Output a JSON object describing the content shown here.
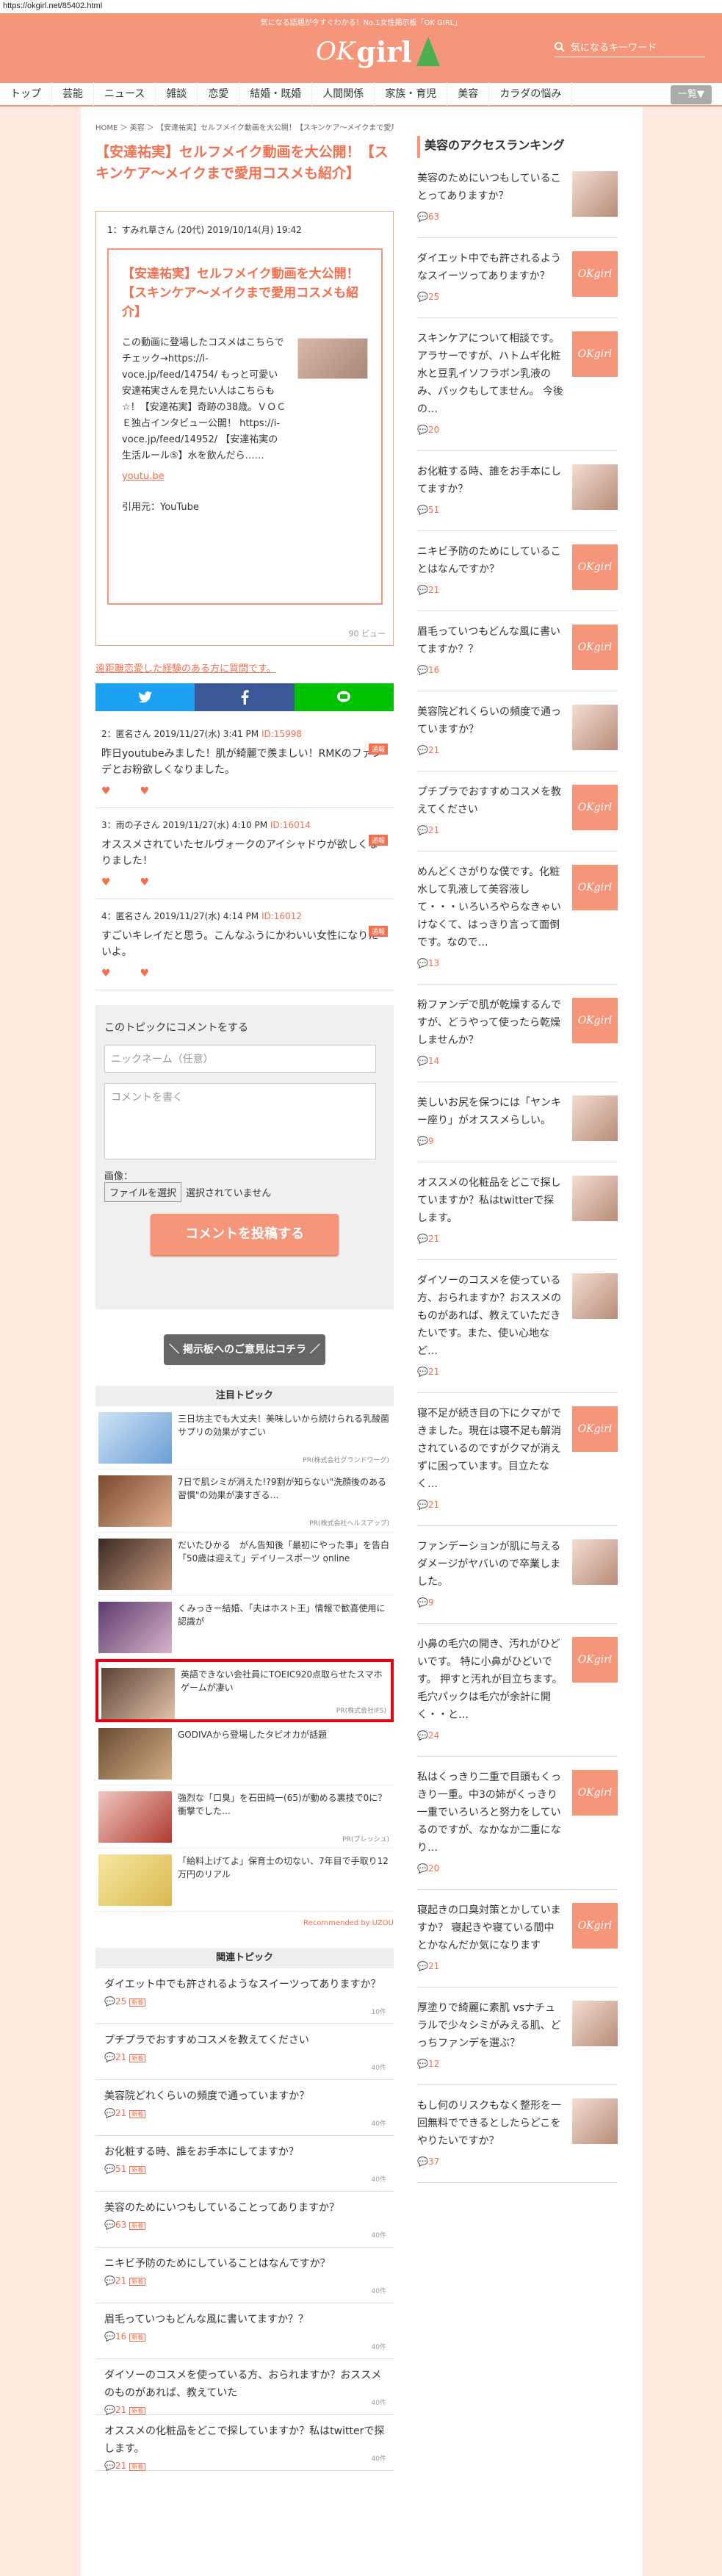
{
  "url": "https://okgirl.net/85402.html",
  "tagline": "気になる話題が今すぐわかる！No.1女性掲示板「OK GIRL」",
  "logo": {
    "ok": "OK",
    "girl": "girl"
  },
  "search": {
    "placeholder": "気になるキーワード"
  },
  "nav": [
    "トップ",
    "芸能",
    "ニュース",
    "雑談",
    "恋愛",
    "結婚・既婚",
    "人間関係",
    "家族・育児",
    "美容",
    "カラダの悩み"
  ],
  "nav_more": "一覧▼",
  "breadcrumb": "HOME ＞ 美容 ＞ 【安達祐実】セルフメイク動画を大公開！【スキンケア〜メイクまで愛用コスメも紹介】",
  "page_title": "【安達祐実】セルフメイク動画を大公開！【スキンケア〜メイクまで愛用コスメも紹介】",
  "first_post": {
    "meta": "1：すみれ草さん (20代) 2019/10/14(月) 19:42",
    "card_title": "【安達祐実】セルフメイク動画を大公開！【スキンケア〜メイクまで愛用コスメも紹介】",
    "card_body": "この動画に登場したコスメはこちらでチェック→https://i-voce.jp/feed/14754/ もっと可愛い安達祐実さんを見たい人はこちらも☆！【安達祐実】奇跡の38歳。ＶＯＣＥ独占インタビュー公開！ https://i-voce.jp/feed/14952/ 【安達祐実の生活ルール⑤】水を飲んだら……",
    "card_link": "youtu.be",
    "source": "引用元：YouTube",
    "views": "90 ビュー"
  },
  "ask_link": "遠距離恋愛した経験のある方に質問です。",
  "comments": [
    {
      "meta": "2：匿名さん 2019/11/27(水) 3:41 PM",
      "id": "ID:15998",
      "tag": "通報",
      "body": "昨日youtubeみました！肌が綺麗で羨ましい！RMKのファンデとお粉欲しくなりました。"
    },
    {
      "meta": "3：雨の子さん 2019/11/27(水) 4:10 PM",
      "id": "ID:16014",
      "tag": "通報",
      "body": "オススメされていたセルヴォークのアイシャドウが欲しくなりました！"
    },
    {
      "meta": "4：匿名さん 2019/11/27(水) 4:14 PM",
      "id": "ID:16012",
      "tag": "通報",
      "body": "すごいキレイだと思う。こんなふうにかわいい女性になりたいよ。"
    }
  ],
  "comment_form": {
    "title": "このトピックにコメントをする",
    "name_placeholder": "ニックネーム（任意）",
    "body_placeholder": "コメントを書く",
    "image_label": "画像：",
    "file_button": "ファイルを選択",
    "file_status": "選択されていません",
    "submit": "コメントを投稿する"
  },
  "bbs_button": "＼ 掲示板へのご意見はコチラ ／",
  "ads_title": "注目トピック",
  "ads": [
    {
      "text": "三日坊主でも大丈夫！美味しいから続けられる乳酸菌サプリの効果がすごい",
      "pr": "PR(株式会社グランドワーグ)"
    },
    {
      "text": "7日で肌シミが消えた!?9割が知らない\"洗顔後のある習慣\"の効果が凄すぎる…",
      "pr": "PR(株式会社ヘルスアップ)"
    },
    {
      "text": "だいたひかる　がん告知後「最初にやった事」を告白「50歳は迎えて」デイリースポーツ online",
      "pr": ""
    },
    {
      "text": "くみっきー結婚、「夫はホスト王」情報で歓喜使用に認識が",
      "pr": ""
    },
    {
      "text": "英語できない会社員にTOEIC920点取らせたスマホゲームが凄い",
      "pr": "PR(株式会社IFS)"
    },
    {
      "text": "GODIVAから登場したタピオカが話題",
      "pr": ""
    },
    {
      "text": "強烈な「口臭」を石田純一(65)が動める裏技で0に？衝撃でした…",
      "pr": "PR(プレッシュ)"
    },
    {
      "text": "「給料上げてよ」保育士の切ない、7年目で手取り12万円のリアル",
      "pr": ""
    }
  ],
  "uzou": "Recommended by UZOU",
  "related_title": "関連トピック",
  "related": [
    {
      "title": "ダイエット中でも許されるようなスイーツってありますか？",
      "count": "25",
      "mark": "新着",
      "num": "10件"
    },
    {
      "title": "プチプラでおすすめコスメを教えてください",
      "count": "21",
      "mark": "新着",
      "num": "40件"
    },
    {
      "title": "美容院どれくらいの頻度で通っていますか？",
      "count": "21",
      "mark": "新着",
      "num": "40件"
    },
    {
      "title": "お化粧する時、誰をお手本にしてますか？",
      "count": "51",
      "mark": "新着",
      "num": "40件"
    },
    {
      "title": "美容のためにいつもしていることってありますか？",
      "count": "63",
      "mark": "新着",
      "num": "40件"
    },
    {
      "title": "ニキビ予防のためにしていることはなんですか？",
      "count": "21",
      "mark": "新着",
      "num": "40件"
    },
    {
      "title": "眉毛っていつもどんな風に書いてますか？？",
      "count": "16",
      "mark": "新着",
      "num": "40件"
    },
    {
      "title": "ダイソーのコスメを使っている方、おられますか？おススメのものがあれば、教えていた",
      "count": "21",
      "mark": "新着",
      "num": "40件"
    },
    {
      "title": "オススメの化粧品をどこで探していますか？私はtwitterで探します。",
      "count": "21",
      "mark": "新着",
      "num": "40件"
    }
  ],
  "side_title": "美容のアクセスランキング",
  "ranking": [
    {
      "text": "美容のためにいつもしていることってありますか？",
      "count": "63",
      "thumb": "photo"
    },
    {
      "text": "ダイエット中でも許されるようなスイーツってありますか？",
      "count": "25",
      "thumb": "ok"
    },
    {
      "text": "スキンケアについて相談です。アラサーですが、ハトムギ化粧水と豆乳イソフラボン乳液のみ、パックもしてません。 今後の…",
      "count": "20",
      "thumb": "ok"
    },
    {
      "text": "お化粧する時、誰をお手本にしてますか？",
      "count": "51",
      "thumb": "photo"
    },
    {
      "text": "ニキビ予防のためにしていることはなんですか？",
      "count": "21",
      "thumb": "ok"
    },
    {
      "text": "眉毛っていつもどんな風に書いてますか？？",
      "count": "16",
      "thumb": "ok"
    },
    {
      "text": "美容院どれくらいの頻度で通っていますか？",
      "count": "21",
      "thumb": "photo"
    },
    {
      "text": "プチプラでおすすめコスメを教えてください",
      "count": "21",
      "thumb": "ok"
    },
    {
      "text": "めんどくさがりな僕です。化粧水して乳液して美容液して・・・いろいろやらなきゃいけなくて、はっきり言って面倒です。なので…",
      "count": "13",
      "thumb": "ok"
    },
    {
      "text": "粉ファンデで肌が乾燥するんですが、どうやって使ったら乾燥しませんか？",
      "count": "14",
      "thumb": "ok"
    },
    {
      "text": "美しいお尻を保つには「ヤンキー座り」がオススメらしい。",
      "count": "9",
      "thumb": "photo"
    },
    {
      "text": "オススメの化粧品をどこで探していますか？私はtwitterで探します。",
      "count": "21",
      "thumb": "photo"
    },
    {
      "text": "ダイソーのコスメを使っている方、おられますか？おススメのものがあれば、教えていただきたいです。また、使い心地など…",
      "count": "21",
      "thumb": "photo"
    },
    {
      "text": "寝不足が続き目の下にクマができました。現在は寝不足も解消されているのですがクマが消えずに困っています。目立たなく…",
      "count": "21",
      "thumb": "ok"
    },
    {
      "text": "ファンデーションが肌に与えるダメージがヤバいので卒業しました。",
      "count": "9",
      "thumb": "photo"
    },
    {
      "text": "小鼻の毛穴の開き、汚れがひどいです。 特に小鼻がひどいです。 押すと汚れが目立ちます。 毛穴パックは毛穴が余計に開く・・と…",
      "count": "24",
      "thumb": "ok"
    },
    {
      "text": "私はくっきり二重で目頭もくっきり一重。中3の姉がくっきり一重でいろいろと努力をしているのですが、なかなか二重になり…",
      "count": "20",
      "thumb": "ok"
    },
    {
      "text": "寝起きの口臭対策とかしていますか？ 寝起きや寝ている間中とかなんだか気になります",
      "count": "21",
      "thumb": "ok"
    },
    {
      "text": "厚塗りで綺麗に素肌 vsナチュラルで少々シミがみえる肌、どっちファンデを選ぶ？",
      "count": "12",
      "thumb": "photo"
    },
    {
      "text": "もし何のリスクもなく整形を一回無料でできるとしたらどこをやりたいですか？",
      "count": "37",
      "thumb": "photo"
    }
  ],
  "colors": {
    "accent": "#f59579",
    "link": "#f2704f",
    "twitter": "#1da1f2",
    "facebook": "#3b5998",
    "line": "#00c300",
    "ad_highlight": "#e3000f"
  }
}
